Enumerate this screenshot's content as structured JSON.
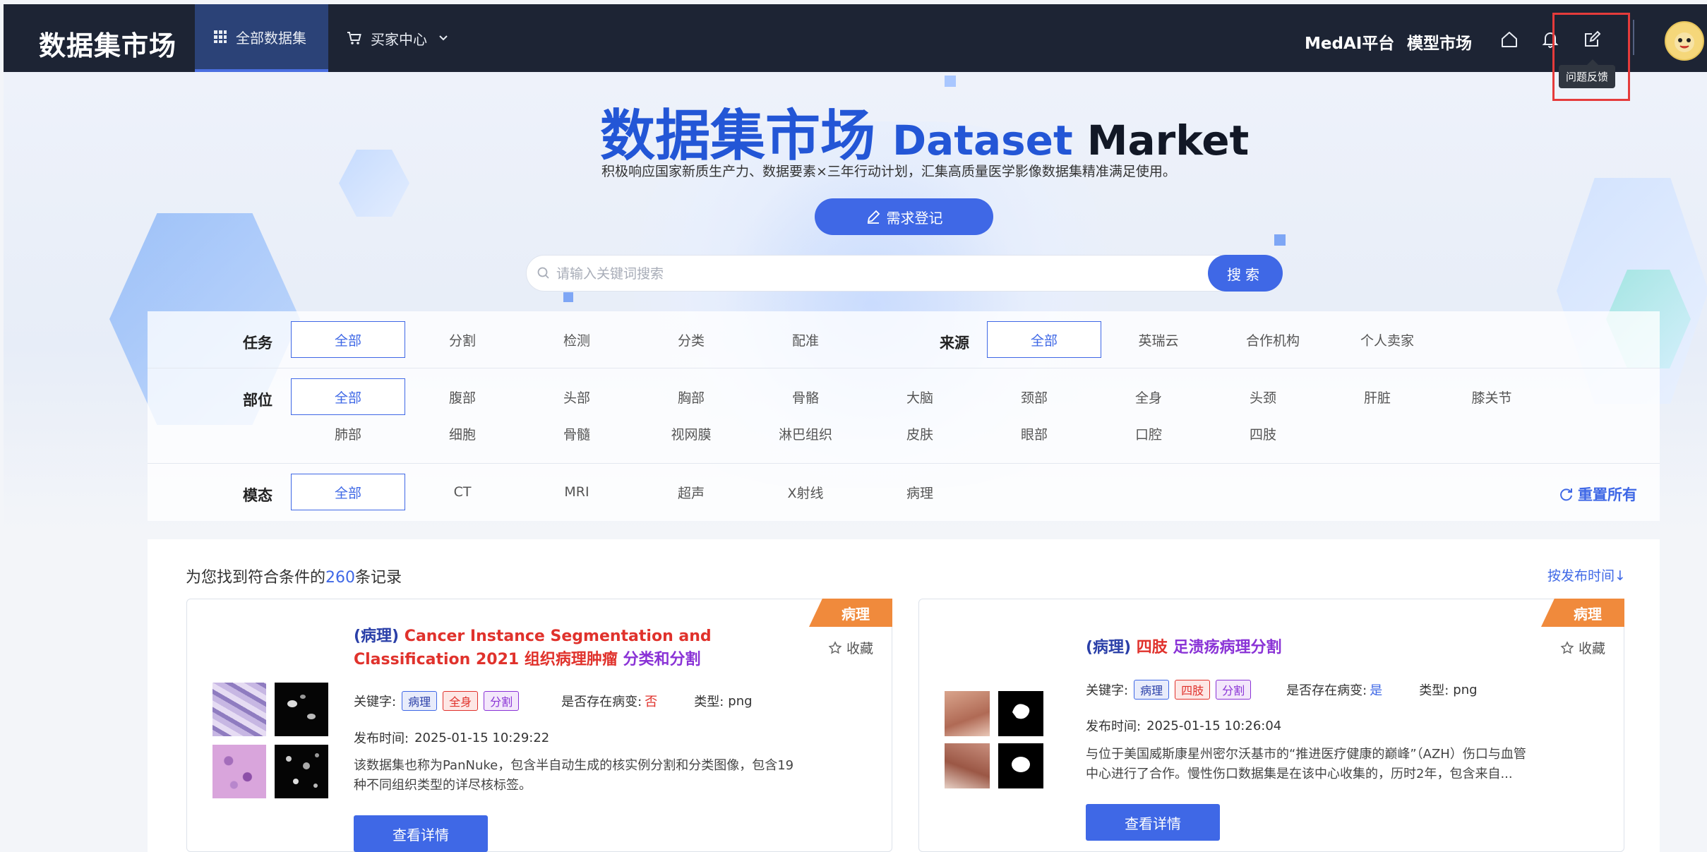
{
  "nav": {
    "brand": "数据集市场",
    "tabs": [
      {
        "label": "全部数据集",
        "icon": "grid-icon"
      },
      {
        "label": "买家中心",
        "icon": "cart-icon"
      }
    ],
    "links": [
      "MedAI平台",
      "模型市场"
    ],
    "tooltip": "问题反馈"
  },
  "hero": {
    "title_cn": "数据集市场",
    "title_en1": "Dataset",
    "title_en2": "Market",
    "subtitle": "积极响应国家新质生产力、数据要素×三年行动计划，汇集高质量医学影像数据集精准满足使用。",
    "request_button": "需求登记",
    "search_placeholder": "请输入关键词搜索",
    "search_button": "搜索"
  },
  "filters": {
    "task": {
      "label": "任务",
      "options": [
        "全部",
        "分割",
        "检测",
        "分类",
        "配准"
      ]
    },
    "source": {
      "label": "来源",
      "options": [
        "全部",
        "英瑞云",
        "合作机构",
        "个人卖家"
      ]
    },
    "part": {
      "label": "部位",
      "row1": [
        "全部",
        "腹部",
        "头部",
        "胸部",
        "骨骼",
        "大脑",
        "颈部",
        "全身",
        "头颈",
        "肝脏",
        "膝关节"
      ],
      "row2": [
        "肺部",
        "细胞",
        "骨髓",
        "视网膜",
        "淋巴组织",
        "皮肤",
        "眼部",
        "口腔",
        "四肢"
      ]
    },
    "modality": {
      "label": "模态",
      "options": [
        "全部",
        "CT",
        "MRI",
        "超声",
        "X射线",
        "病理"
      ]
    },
    "reset": "重置所有"
  },
  "results": {
    "prefix": "为您找到符合条件的",
    "count": "260",
    "suffix": "条记录",
    "sort": "按发布时间↓"
  },
  "cards": [
    {
      "ribbon": "病理",
      "title_tag": "(病理)",
      "title_main": "Cancer Instance Segmentation and Classification 2021 组织病理肿瘤",
      "title_suffix": "分类和分割",
      "collect": "收藏",
      "keywords_label": "关键字:",
      "keywords": [
        "病理",
        "全身",
        "分割"
      ],
      "lesion_label": "是否存在病变:",
      "lesion_value": "否",
      "type_label": "类型:",
      "type_value": "png",
      "date_label": "发布时间:",
      "date_value": "2025-01-15 10:29:22",
      "description": "该数据集也称为PanNuke，包含半自动生成的核实例分割和分类图像，包含19种不同组织类型的详尽核标签。",
      "detail_button": "查看详情"
    },
    {
      "ribbon": "病理",
      "title_tag": "(病理)",
      "title_main": "四肢",
      "title_suffix": "足溃疡病理分割",
      "collect": "收藏",
      "keywords_label": "关键字:",
      "keywords": [
        "病理",
        "四肢",
        "分割"
      ],
      "lesion_label": "是否存在病变:",
      "lesion_value": "是",
      "type_label": "类型:",
      "type_value": "png",
      "date_label": "发布时间:",
      "date_value": "2025-01-15 10:26:04",
      "description": "与位于美国威斯康星州密尔沃基市的“推进医疗健康的巅峰”（AZH）伤口与血管中心进行了合作。慢性伤口数据集是在该中心收集的，历时2年，包含来自...",
      "detail_button": "查看详情"
    }
  ],
  "colors": {
    "nav_bg": "#1d2434",
    "accent": "#3f68e6",
    "ribbon": "#f08a3c",
    "red": "#e0322c",
    "purple": "#8a33d6"
  }
}
